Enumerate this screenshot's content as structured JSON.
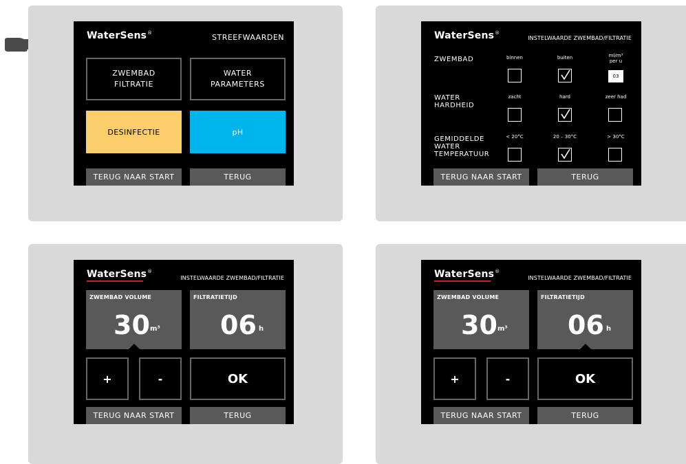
{
  "brand": {
    "name": "WaterSens",
    "reg": "®",
    "accent": "#d0202a"
  },
  "screen1": {
    "title": "STREEFWAARDEN",
    "btn_zwembad": "ZWEMBAD",
    "btn_zwembad2": "FILTRATIE",
    "btn_water": "WATER",
    "btn_water2": "PARAMETERS",
    "btn_desinfectie": "DESINFECTIE",
    "btn_ph": "pH",
    "colors": {
      "desinfectie": "#fbcd6b",
      "ph": "#00b4ec"
    },
    "footer_start": "TERUG NAAR START",
    "footer_back": "TERUG"
  },
  "screen2": {
    "title": "INSTELWAARDE ZWEMBAD/FILTRATIE",
    "row1_label": "ZWEMBAD",
    "row1_cols": [
      "binnen",
      "buiten",
      "ml/m³",
      "per u"
    ],
    "row1_checked": "buiten",
    "row1_value": "03",
    "row2_label1": "WATER",
    "row2_label2": "HARDHEID",
    "row2_cols": [
      "zacht",
      "hard",
      "zeer had"
    ],
    "row2_checked": "hard",
    "row3_label1": "GEMIDDELDE",
    "row3_label2": "WATER",
    "row3_label3": "TEMPERATUUR",
    "row3_cols": [
      "< 20°C",
      "20 – 30°C",
      "> 30°C"
    ],
    "row3_checked": "20 – 30°C",
    "footer_start": "TERUG NAAR START",
    "footer_back": "TERUG"
  },
  "screen3": {
    "title": "INSTELWAARDE ZWEMBAD/FILTRATIE",
    "volume_label": "ZWEMBAD VOLUME",
    "volume_value": "30",
    "volume_unit": "m³",
    "filt_label": "FILTRATIETIJD",
    "filt_value": "06",
    "filt_unit": "h",
    "selected": "volume",
    "plus": "+",
    "minus": "-",
    "ok": "OK",
    "footer_start": "TERUG NAAR START",
    "footer_back": "TERUG"
  },
  "screen4": {
    "title": "INSTELWAARDE ZWEMBAD/FILTRATIE",
    "volume_label": "ZWEMBAD VOLUME",
    "volume_value": "30",
    "volume_unit": "m³",
    "filt_label": "FILTRATIETIJD",
    "filt_value": "06",
    "filt_unit": "h",
    "selected": "filtratietijd",
    "plus": "+",
    "minus": "-",
    "ok": "OK",
    "footer_start": "TERUG NAAR START",
    "footer_back": "TERUG"
  },
  "icons": {
    "pointer": "pointing-hand-icon",
    "check": "checkmark-icon"
  }
}
